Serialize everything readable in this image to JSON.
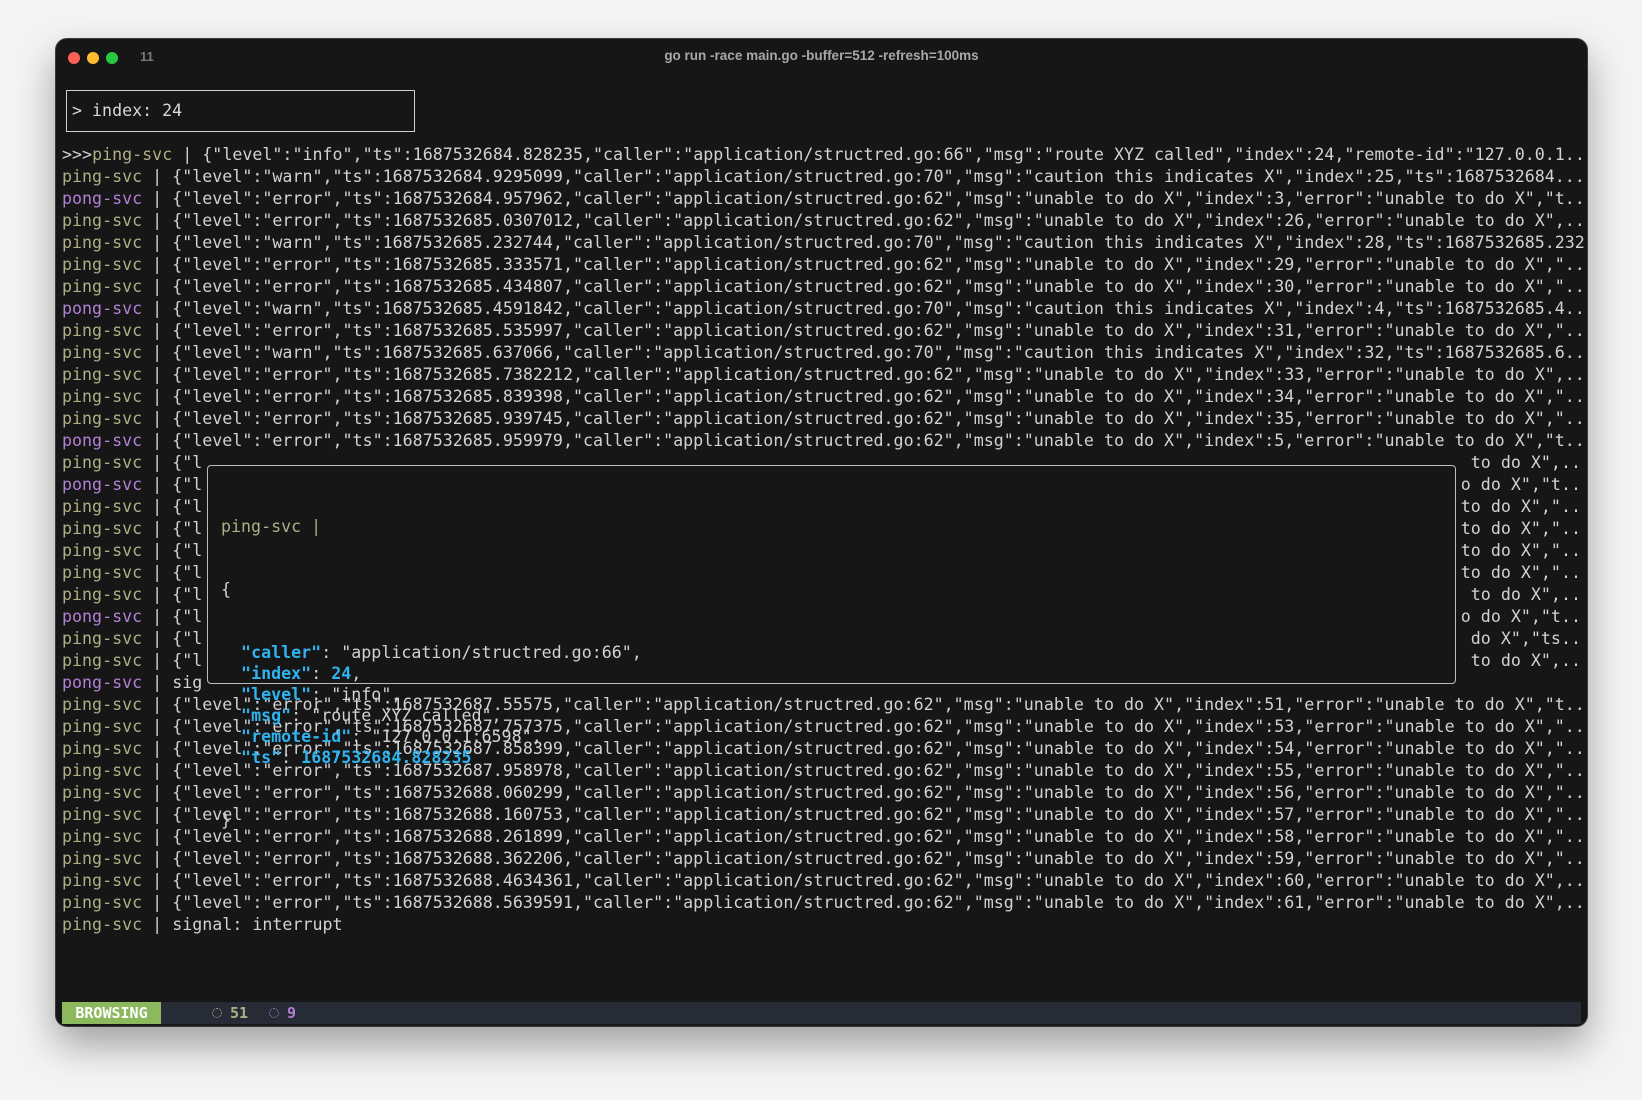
{
  "window": {
    "tab_number": "11",
    "title": "go run -race main.go -buffer=512 -refresh=100ms"
  },
  "search": {
    "value": "> index: 24"
  },
  "colors": {
    "ping": "#aeae85",
    "pong": "#b27fd6",
    "json_key": "#2fb4ef",
    "mode_bg": "#8cb95e",
    "status_bg": "#272b36"
  },
  "log": [
    {
      "marker": ">>>",
      "svc": "ping-svc",
      "text": "{\"level\":\"info\",\"ts\":1687532684.828235,\"caller\":\"application/structred.go:66\",\"msg\":\"route XYZ called\",\"index\":24,\"remote-id\":\"127.0.0.1..",
      "selected": true
    },
    {
      "svc": "ping-svc",
      "text": "{\"level\":\"warn\",\"ts\":1687532684.9295099,\"caller\":\"application/structred.go:70\",\"msg\":\"caution this indicates X\",\"index\":25,\"ts\":1687532684..."
    },
    {
      "svc": "pong-svc",
      "text": "{\"level\":\"error\",\"ts\":1687532684.957962,\"caller\":\"application/structred.go:62\",\"msg\":\"unable to do X\",\"index\":3,\"error\":\"unable to do X\",\"t.."
    },
    {
      "svc": "ping-svc",
      "text": "{\"level\":\"error\",\"ts\":1687532685.0307012,\"caller\":\"application/structred.go:62\",\"msg\":\"unable to do X\",\"index\":26,\"error\":\"unable to do X\",.."
    },
    {
      "svc": "ping-svc",
      "text": "{\"level\":\"warn\",\"ts\":1687532685.232744,\"caller\":\"application/structred.go:70\",\"msg\":\"caution this indicates X\",\"index\":28,\"ts\":1687532685.232"
    },
    {
      "svc": "ping-svc",
      "text": "{\"level\":\"error\",\"ts\":1687532685.333571,\"caller\":\"application/structred.go:62\",\"msg\":\"unable to do X\",\"index\":29,\"error\":\"unable to do X\",\".."
    },
    {
      "svc": "ping-svc",
      "text": "{\"level\":\"error\",\"ts\":1687532685.434807,\"caller\":\"application/structred.go:62\",\"msg\":\"unable to do X\",\"index\":30,\"error\":\"unable to do X\",\".."
    },
    {
      "svc": "pong-svc",
      "text": "{\"level\":\"warn\",\"ts\":1687532685.4591842,\"caller\":\"application/structred.go:70\",\"msg\":\"caution this indicates X\",\"index\":4,\"ts\":1687532685.4.."
    },
    {
      "svc": "ping-svc",
      "text": "{\"level\":\"error\",\"ts\":1687532685.535997,\"caller\":\"application/structred.go:62\",\"msg\":\"unable to do X\",\"index\":31,\"error\":\"unable to do X\",\".."
    },
    {
      "svc": "ping-svc",
      "text": "{\"level\":\"warn\",\"ts\":1687532685.637066,\"caller\":\"application/structred.go:70\",\"msg\":\"caution this indicates X\",\"index\":32,\"ts\":1687532685.6.."
    },
    {
      "svc": "ping-svc",
      "text": "{\"level\":\"error\",\"ts\":1687532685.7382212,\"caller\":\"application/structred.go:62\",\"msg\":\"unable to do X\",\"index\":33,\"error\":\"unable to do X\",.."
    },
    {
      "svc": "ping-svc",
      "text": "{\"level\":\"error\",\"ts\":1687532685.839398,\"caller\":\"application/structred.go:62\",\"msg\":\"unable to do X\",\"index\":34,\"error\":\"unable to do X\",\".."
    },
    {
      "svc": "ping-svc",
      "text": "{\"level\":\"error\",\"ts\":1687532685.939745,\"caller\":\"application/structred.go:62\",\"msg\":\"unable to do X\",\"index\":35,\"error\":\"unable to do X\",\".."
    },
    {
      "svc": "pong-svc",
      "text": "{\"level\":\"error\",\"ts\":1687532685.959979,\"caller\":\"application/structred.go:62\",\"msg\":\"unable to do X\",\"index\":5,\"error\":\"unable to do X\",\"t.."
    },
    {
      "svc": "ping-svc",
      "text": "{\"l",
      "tail": " to do X\",.."
    },
    {
      "svc": "pong-svc",
      "text": "{\"l",
      "tail": "o do X\",\"t.."
    },
    {
      "svc": "ping-svc",
      "text": "{\"l",
      "tail": "to do X\",\".."
    },
    {
      "svc": "ping-svc",
      "text": "{\"l",
      "tail": "to do X\",\".."
    },
    {
      "svc": "ping-svc",
      "text": "{\"l",
      "tail": "to do X\",\".."
    },
    {
      "svc": "ping-svc",
      "text": "{\"l",
      "tail": "to do X\",\".."
    },
    {
      "svc": "ping-svc",
      "text": "{\"l",
      "tail": " to do X\",.."
    },
    {
      "svc": "pong-svc",
      "text": "{\"l",
      "tail": "o do X\",\"t.."
    },
    {
      "svc": "ping-svc",
      "text": "{\"l",
      "tail": " do X\",\"ts.."
    },
    {
      "svc": "ping-svc",
      "text": "{\"l",
      "tail": " to do X\",.."
    },
    {
      "svc": "pong-svc",
      "text": "sig"
    },
    {
      "svc": "ping-svc",
      "text": "{\"level\":\"error\",\"ts\":1687532687.55575,\"caller\":\"application/structred.go:62\",\"msg\":\"unable to do X\",\"index\":51,\"error\":\"unable to do X\",\"t.."
    },
    {
      "svc": "ping-svc",
      "text": "{\"level\":\"error\",\"ts\":1687532687.757375,\"caller\":\"application/structred.go:62\",\"msg\":\"unable to do X\",\"index\":53,\"error\":\"unable to do X\",\".."
    },
    {
      "svc": "ping-svc",
      "text": "{\"level\":\"error\",\"ts\":1687532687.858399,\"caller\":\"application/structred.go:62\",\"msg\":\"unable to do X\",\"index\":54,\"error\":\"unable to do X\",\".."
    },
    {
      "svc": "ping-svc",
      "text": "{\"level\":\"error\",\"ts\":1687532687.958978,\"caller\":\"application/structred.go:62\",\"msg\":\"unable to do X\",\"index\":55,\"error\":\"unable to do X\",\".."
    },
    {
      "svc": "ping-svc",
      "text": "{\"level\":\"error\",\"ts\":1687532688.060299,\"caller\":\"application/structred.go:62\",\"msg\":\"unable to do X\",\"index\":56,\"error\":\"unable to do X\",\".."
    },
    {
      "svc": "ping-svc",
      "text": "{\"level\":\"error\",\"ts\":1687532688.160753,\"caller\":\"application/structred.go:62\",\"msg\":\"unable to do X\",\"index\":57,\"error\":\"unable to do X\",\".."
    },
    {
      "svc": "ping-svc",
      "text": "{\"level\":\"error\",\"ts\":1687532688.261899,\"caller\":\"application/structred.go:62\",\"msg\":\"unable to do X\",\"index\":58,\"error\":\"unable to do X\",\".."
    },
    {
      "svc": "ping-svc",
      "text": "{\"level\":\"error\",\"ts\":1687532688.362206,\"caller\":\"application/structred.go:62\",\"msg\":\"unable to do X\",\"index\":59,\"error\":\"unable to do X\",\".."
    },
    {
      "svc": "ping-svc",
      "text": "{\"level\":\"error\",\"ts\":1687532688.4634361,\"caller\":\"application/structred.go:62\",\"msg\":\"unable to do X\",\"index\":60,\"error\":\"unable to do X\",.."
    },
    {
      "svc": "ping-svc",
      "text": "{\"level\":\"error\",\"ts\":1687532688.5639591,\"caller\":\"application/structred.go:62\",\"msg\":\"unable to do X\",\"index\":61,\"error\":\"unable to do X\",.."
    },
    {
      "svc": "ping-svc",
      "text": "signal: interrupt"
    }
  ],
  "popup": {
    "header": "ping-svc |",
    "open": "{",
    "close": "}",
    "fields": [
      {
        "key": "caller",
        "value": "\"application/structred.go:66\"",
        "type": "string",
        "comma": true
      },
      {
        "key": "index",
        "value": "24",
        "type": "number",
        "comma": true
      },
      {
        "key": "level",
        "value": "\"info\"",
        "type": "string",
        "comma": true
      },
      {
        "key": "msg",
        "value": "\"route XYZ called\"",
        "type": "string",
        "comma": true
      },
      {
        "key": "remote-id",
        "value": "\"127.0.0.1:6598\"",
        "type": "string",
        "comma": true
      },
      {
        "key": "ts",
        "value": "1687532684.828235",
        "type": "number",
        "comma": false
      }
    ]
  },
  "status": {
    "mode": "BROWSING",
    "ping_count": "51",
    "pong_count": "9",
    "count_icon": "dotted-circle-icon"
  }
}
